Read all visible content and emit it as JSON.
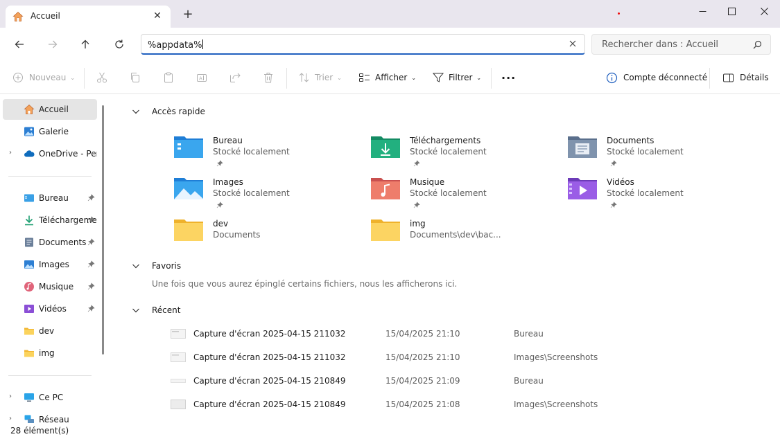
{
  "window": {
    "tab_title": "Accueil",
    "new_tab": "+"
  },
  "address": {
    "value": "%appdata%"
  },
  "search": {
    "placeholder": "Rechercher dans : Accueil"
  },
  "toolbar": {
    "new": "Nouveau",
    "sort": "Trier",
    "view": "Afficher",
    "filter": "Filtrer",
    "more": "···",
    "account": "Compte déconnecté",
    "details": "Détails"
  },
  "sidebar": {
    "items": [
      {
        "label": "Accueil"
      },
      {
        "label": "Galerie"
      },
      {
        "label": "OneDrive - Perso"
      },
      {
        "label": "Bureau"
      },
      {
        "label": "Téléchargements"
      },
      {
        "label": "Documents"
      },
      {
        "label": "Images"
      },
      {
        "label": "Musique"
      },
      {
        "label": "Vidéos"
      },
      {
        "label": "dev"
      },
      {
        "label": "img"
      },
      {
        "label": "Ce PC"
      },
      {
        "label": "Réseau"
      }
    ]
  },
  "quick_access": {
    "title": "Accès rapide",
    "items": [
      {
        "name": "Bureau",
        "sub": "Stocké localement"
      },
      {
        "name": "Téléchargements",
        "sub": "Stocké localement"
      },
      {
        "name": "Documents",
        "sub": "Stocké localement"
      },
      {
        "name": "Images",
        "sub": "Stocké localement"
      },
      {
        "name": "Musique",
        "sub": "Stocké localement"
      },
      {
        "name": "Vidéos",
        "sub": "Stocké localement"
      },
      {
        "name": "dev",
        "sub": "Documents"
      },
      {
        "name": "img",
        "sub": "Documents\\dev\\bac..."
      }
    ]
  },
  "favorites": {
    "title": "Favoris",
    "empty_text": "Une fois que vous aurez épinglé certains fichiers, nous les afficherons ici."
  },
  "recent": {
    "title": "Récent",
    "rows": [
      {
        "name": "Capture d'écran 2025-04-15 211032",
        "date": "15/04/2025 21:10",
        "location": "Bureau"
      },
      {
        "name": "Capture d'écran 2025-04-15 211032",
        "date": "15/04/2025 21:10",
        "location": "Images\\Screenshots"
      },
      {
        "name": "Capture d'écran 2025-04-15 210849",
        "date": "15/04/2025 21:09",
        "location": "Bureau"
      },
      {
        "name": "Capture d'écran 2025-04-15 210849",
        "date": "15/04/2025 21:08",
        "location": "Images\\Screenshots"
      }
    ]
  },
  "status": {
    "count": "28 élément(s)"
  },
  "colors": {
    "accent": "#1f5fbf",
    "folder_yellow": "#f7c948",
    "selection": "#e5e5e5"
  }
}
